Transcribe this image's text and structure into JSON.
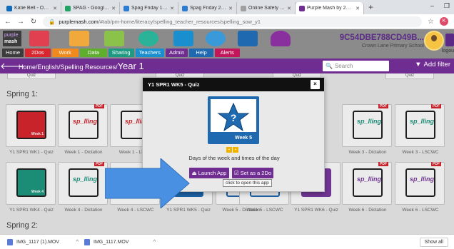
{
  "browser": {
    "tabs": [
      {
        "title": "Katie Bell - Outlook We",
        "color": "#0f6cbd"
      },
      {
        "title": "SPAG - Google Drive",
        "color": "#1fa463"
      },
      {
        "title": "Spag Friday 150520.do",
        "color": "#2b7cd3"
      },
      {
        "title": "Spag Friday 220520.do",
        "color": "#2b7cd3"
      },
      {
        "title": "Online Safety Goes Wi",
        "color": "#a0a0a0"
      },
      {
        "title": "Purple Mash by 2Simp",
        "color": "#6f2c91"
      }
    ],
    "new_tab": "+",
    "url_domain": "purplemash.com",
    "url_path": "/#tab/pm-home/literacy/spelling_teacher_resources/spelling_sow_y1",
    "profile_initial": "K"
  },
  "header": {
    "logo_line1": "purple",
    "logo_line2": "mash",
    "nav": [
      {
        "label": "Home",
        "color": "#3c3c3c"
      },
      {
        "label": "2Dos",
        "color": "#d9262f"
      },
      {
        "label": "Work",
        "color": "#f08a1c"
      },
      {
        "label": "Data",
        "color": "#5fae2e"
      },
      {
        "label": "Sharing",
        "color": "#1e9a82"
      },
      {
        "label": "Teachers",
        "color": "#1a8fd0"
      },
      {
        "label": "Admin",
        "color": "#6f2c91"
      },
      {
        "label": "Help",
        "color": "#1e69b0"
      },
      {
        "label": "Alerts",
        "color": "#c2185b"
      }
    ],
    "account_code": "9C54DBE788CD49B...",
    "school": "Crown Lane Primary School",
    "logout": "logou"
  },
  "breadcrumb": {
    "path": "Home/English/Spelling Resources/",
    "year": "Year 1",
    "search_placeholder": "Search",
    "filter_label": "Add filter"
  },
  "content": {
    "top_labels": [
      "Quiz",
      "Quiz",
      "Quiz",
      "Quiz"
    ],
    "section1": "Spring 1:",
    "section2": "Spring 2:",
    "row1": [
      {
        "label": "Y1 SPR1 WK1 - Quiz",
        "week": "Week 1"
      },
      {
        "label": "Week 1 - Dictation",
        "week": "Week 1"
      },
      {
        "label": "Week 1 - LSCW",
        "week": "Week 1"
      },
      {
        "label": "Week 3 - Dictation",
        "week": "Week 3"
      },
      {
        "label": "Week 3 - LSCWC",
        "week": "Week 3"
      }
    ],
    "row2": [
      {
        "label": "Y1 SPR1 WK4 - Quiz",
        "week": "Week 4"
      },
      {
        "label": "Week 4 - Dictation",
        "week": "Week 4"
      },
      {
        "label": "Week 4 - LSCWC",
        "week": "Week 4"
      },
      {
        "label": "Y1 SPR1 WK5 - Quiz",
        "week": "Week 5"
      },
      {
        "label": "Week 5 - Dictation",
        "week": "Week 5"
      },
      {
        "label": "Week 5 - LSCWC",
        "week": "Week 5"
      },
      {
        "label": "Y1 SPR1 WK6 - Quiz",
        "week": "Week 6"
      },
      {
        "label": "Week 6 - Dictation",
        "week": "Week 6"
      },
      {
        "label": "Week 6 - LSCWC",
        "week": "Week 6"
      }
    ],
    "pdf_badge": "PDF"
  },
  "modal": {
    "title": "Y1 SPR1 WK5 - Quiz",
    "close": "×",
    "icon_week": "Week 5",
    "description": "Days of the week and times of the day",
    "launch_label": "Launch App",
    "set_2do_label": "Set as a 2Do",
    "tooltip": "click to open this app"
  },
  "downloads": {
    "items": [
      "IMG_1117 (1).MOV",
      "IMG_1117.MOV"
    ],
    "show_all": "Show all"
  }
}
